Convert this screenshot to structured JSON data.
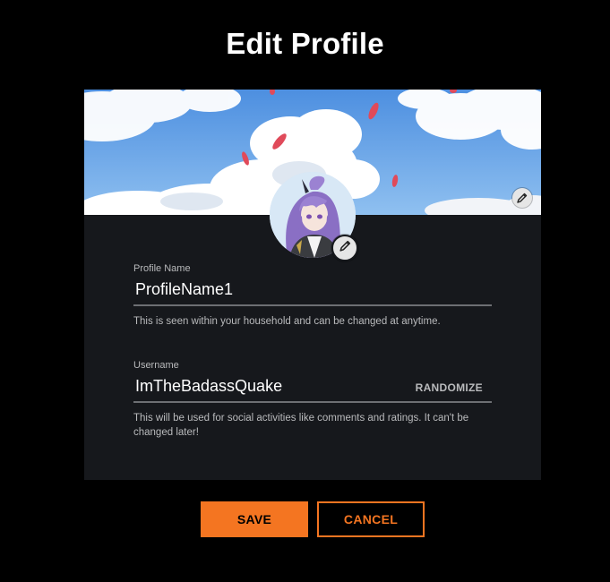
{
  "page": {
    "title": "Edit Profile"
  },
  "profile_name": {
    "label": "Profile Name",
    "value": "ProfileName1",
    "help": "This is seen within your household and can be changed at anytime."
  },
  "username": {
    "label": "Username",
    "value": "ImTheBadassQuake",
    "randomize_label": "RANDOMIZE",
    "help": "This will be used for social activities like comments and ratings. It can't be changed later!"
  },
  "actions": {
    "save_label": "SAVE",
    "cancel_label": "CANCEL"
  },
  "icons": {
    "banner_edit": "pencil-icon",
    "avatar_edit": "pencil-icon"
  },
  "colors": {
    "accent": "#f47521",
    "background": "#000000",
    "card": "#16181c",
    "text_primary": "#ffffff",
    "text_secondary": "#b9babc"
  }
}
